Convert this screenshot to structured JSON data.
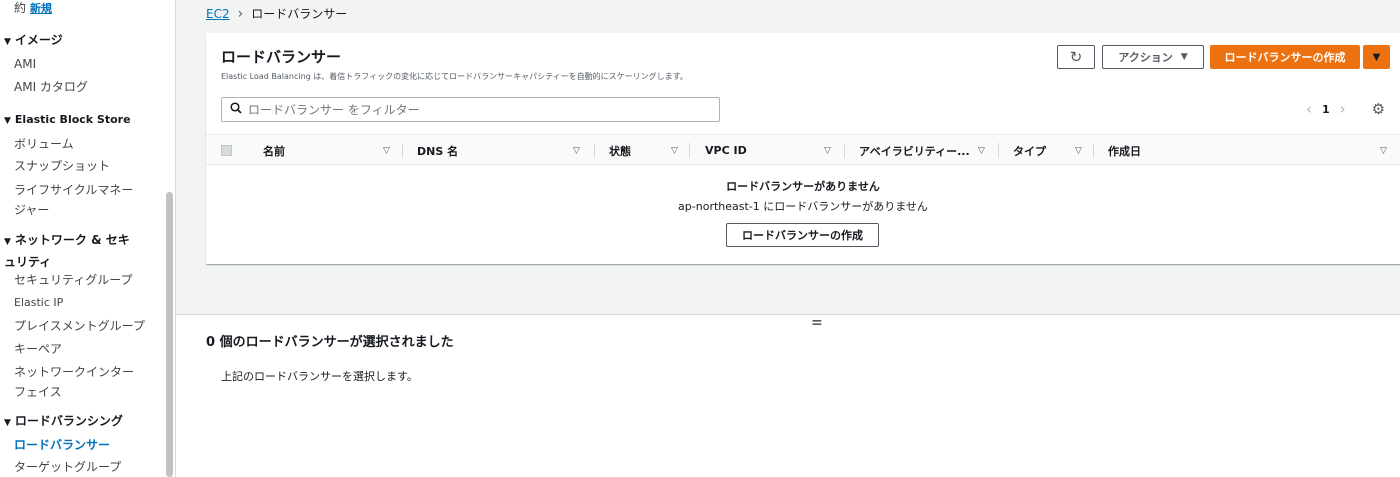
{
  "sidebar": {
    "partial_label": "約",
    "new_badge": "新規",
    "sections": [
      {
        "title": "イメージ",
        "items": [
          "AMI",
          "AMI カタログ"
        ]
      },
      {
        "title": "Elastic Block Store",
        "items": [
          "ボリューム",
          "スナップショット",
          "ライフサイクルマネージャー"
        ]
      },
      {
        "title": "ネットワーク & セキュリティ",
        "items": [
          "セキュリティグループ",
          "Elastic IP",
          "プレイスメントグループ",
          "キーペア",
          "ネットワークインターフェイス"
        ]
      },
      {
        "title": "ロードバランシング",
        "items": [
          "ロードバランサー",
          "ターゲットグループ"
        ]
      }
    ]
  },
  "breadcrumb": {
    "root": "EC2",
    "current": "ロードバランサー"
  },
  "panel": {
    "title": "ロードバランサー",
    "description": "Elastic Load Balancing は、着信トラフィックの変化に応じてロードバランサーキャパシティーを自動的にスケーリングします。",
    "refresh_icon": "↻",
    "actions_label": "アクション",
    "create_label": "ロードバランサーの作成",
    "filter_placeholder": "ロードバランサー をフィルター",
    "page_number": "1",
    "columns": [
      "名前",
      "DNS 名",
      "状態",
      "VPC ID",
      "アベイラビリティー...",
      "タイプ",
      "作成日"
    ],
    "empty_title": "ロードバランサーがありません",
    "empty_subtitle": "ap-northeast-1 にロードバランサーがありません",
    "empty_create_label": "ロードバランサーの作成"
  },
  "lower": {
    "handle": "=",
    "title": "0 個のロードバランサーが選択されました",
    "text": "上記のロードバランサーを選択します。"
  },
  "colors": {
    "accent_orange": "#ec7211",
    "link_blue": "#0073bb"
  }
}
